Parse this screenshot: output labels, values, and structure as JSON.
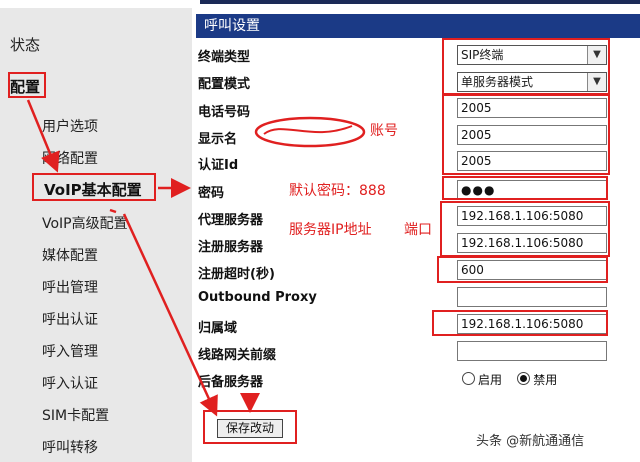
{
  "sidebar": {
    "status": "状态",
    "config": "配置",
    "items": [
      "用户选项",
      "网络配置",
      "VoIP基本配置",
      "VoIP高级配置",
      "媒体配置",
      "呼出管理",
      "呼出认证",
      "呼入管理",
      "呼入认证",
      "SIM卡配置",
      "呼叫转移"
    ]
  },
  "panel": {
    "title": "呼叫设置"
  },
  "fields": {
    "terminal_type": {
      "label": "终端类型",
      "value": "SIP终端"
    },
    "config_mode": {
      "label": "配置模式",
      "value": "单服务器模式"
    },
    "phone_number": {
      "label": "电话号码",
      "value": "2005"
    },
    "display_name": {
      "label": "显示名",
      "value": "2005"
    },
    "auth_id": {
      "label": "认证Id",
      "value": "2005"
    },
    "password": {
      "label": "密码",
      "value": "●●●"
    },
    "proxy_server": {
      "label": "代理服务器",
      "value": "192.168.1.106:5080"
    },
    "register_server": {
      "label": "注册服务器",
      "value": "192.168.1.106:5080"
    },
    "register_timeout": {
      "label": "注册超时(秒)",
      "value": "600"
    },
    "outbound_proxy": {
      "label": "Outbound Proxy",
      "value": ""
    },
    "home_domain": {
      "label": "归属域",
      "value": "192.168.1.106:5080"
    },
    "gateway_prefix": {
      "label": "线路网关前缀",
      "value": ""
    },
    "backup_server": {
      "label": "后备服务器",
      "enable": "启用",
      "disable": "禁用"
    }
  },
  "save_button": "保存改动",
  "annotations": {
    "account": "账号",
    "default_password": "默认密码：888",
    "server_ip": "服务器IP地址",
    "port": "端口"
  },
  "watermark": "头条 @新航通通信",
  "colors": {
    "annotation_red": "#e02020",
    "header_blue": "#1b3a86",
    "sidebar_gray": "#e8e8e8"
  }
}
